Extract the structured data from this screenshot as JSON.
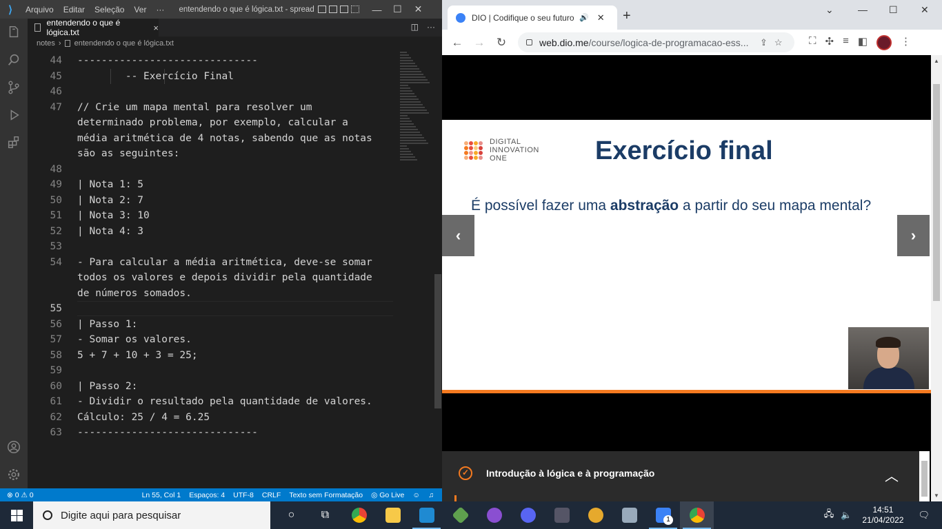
{
  "vscode": {
    "menu": [
      "Arquivo",
      "Editar",
      "Seleção",
      "Ver",
      "···"
    ],
    "window_title": "entendendo o que é lógica.txt - spread-full...",
    "tab": {
      "label": "entendendo o que é lógica.txt",
      "close": "×"
    },
    "breadcrumb": {
      "folder": "notes",
      "file": "entendendo o que é lógica.txt"
    },
    "lines": [
      {
        "n": "44",
        "text": "------------------------------"
      },
      {
        "n": "45",
        "text": "        -- Exercício Final"
      },
      {
        "n": "46",
        "text": ""
      },
      {
        "n": "47",
        "text": "// Crie um mapa mental para resolver um\ndeterminado problema, por exemplo, calcular a\nmédia aritmética de 4 notas, sabendo que as notas\nsão as seguintes:"
      },
      {
        "n": "48",
        "text": ""
      },
      {
        "n": "49",
        "text": "| Nota 1: 5"
      },
      {
        "n": "50",
        "text": "| Nota 2: 7"
      },
      {
        "n": "51",
        "text": "| Nota 3: 10"
      },
      {
        "n": "52",
        "text": "| Nota 4: 3"
      },
      {
        "n": "53",
        "text": ""
      },
      {
        "n": "54",
        "text": "- Para calcular a média aritmética, deve-se somar\ntodos os valores e depois dividir pela quantidade\nde números somados."
      },
      {
        "n": "55",
        "text": ""
      },
      {
        "n": "56",
        "text": "| Passo 1:"
      },
      {
        "n": "57",
        "text": "- Somar os valores."
      },
      {
        "n": "58",
        "text": "5 + 7 + 10 + 3 = 25;"
      },
      {
        "n": "59",
        "text": ""
      },
      {
        "n": "60",
        "text": "| Passo 2:"
      },
      {
        "n": "61",
        "text": "- Dividir o resultado pela quantidade de valores."
      },
      {
        "n": "62",
        "text": "Cálculo: 25 / 4 = 6.25"
      },
      {
        "n": "63",
        "text": "------------------------------"
      }
    ],
    "status": {
      "problems": "⊗ 0 ⚠ 0",
      "position": "Ln 55, Col 1",
      "spaces": "Espaços: 4",
      "encoding": "UTF-8",
      "eol": "CRLF",
      "language": "Texto sem Formatação",
      "golive": "Go Live"
    },
    "accent_color": "#007acc"
  },
  "browser": {
    "tab_title": "DIO | Codifique o seu futuro",
    "url_domain": "web.dio.me",
    "url_path": "/course/logica-de-programacao-ess...",
    "slide": {
      "logo_lines": [
        "DIGITAL",
        "INNOVATION",
        "ONE"
      ],
      "title": "Exercício final",
      "body_before": "É possível fazer uma ",
      "body_bold": "abstração",
      "body_after": " a partir do seu mapa mental?"
    },
    "course_section": "Introdução à lógica e à programação",
    "brand_color": "#f47a20",
    "title_color": "#1b3c66"
  },
  "taskbar": {
    "search_placeholder": "Digite aqui para pesquisar",
    "time": "14:51",
    "date": "21/04/2022",
    "badge": "1"
  }
}
